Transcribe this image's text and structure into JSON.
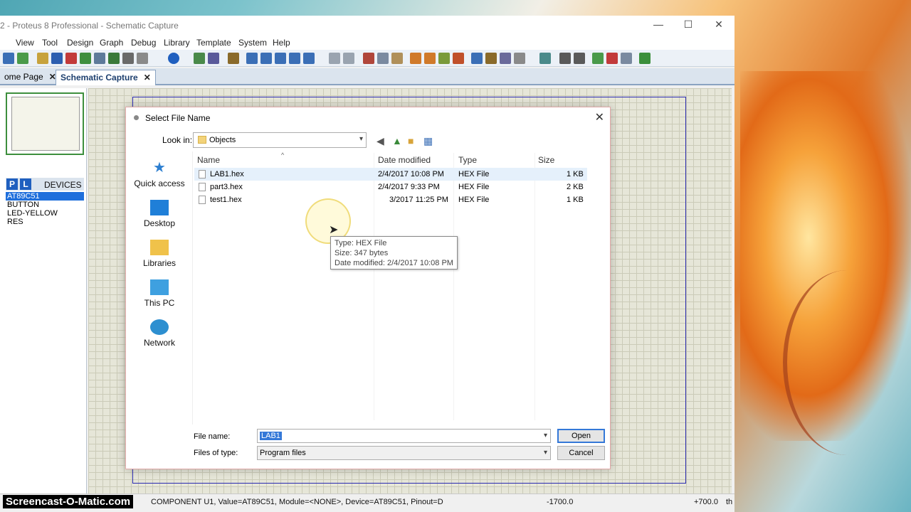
{
  "window": {
    "title": "2 - Proteus 8 Professional - Schematic Capture"
  },
  "menu": [
    "View",
    "Tool",
    "Design",
    "Graph",
    "Debug",
    "Library",
    "Template",
    "System",
    "Help"
  ],
  "tabs": [
    {
      "label": "ome Page"
    },
    {
      "label": "Schematic Capture"
    }
  ],
  "devices_panel": {
    "p_label": "P",
    "l_label": "L",
    "title": "DEVICES",
    "items": [
      "AT89C51",
      "BUTTON",
      "LED-YELLOW",
      "RES"
    ]
  },
  "statusbar": {
    "component_info": "COMPONENT U1, Value=AT89C51, Module=<NONE>, Device=AT89C51, Pinout=D",
    "x_coord": "-1700.0",
    "y_coord": "+700.0",
    "units": "th"
  },
  "watermark": "Screencast-O-Matic.com",
  "dialog": {
    "title": "Select File Name",
    "look_in_label": "Look in:",
    "look_in_value": "Objects",
    "places": [
      "Quick access",
      "Desktop",
      "Libraries",
      "This PC",
      "Network"
    ],
    "columns": [
      "Name",
      "Date modified",
      "Type",
      "Size"
    ],
    "files": [
      {
        "name": "LAB1.hex",
        "date": "2/4/2017 10:08 PM",
        "type": "HEX File",
        "size": "1 KB"
      },
      {
        "name": "part3.hex",
        "date": "2/4/2017 9:33 PM",
        "type": "HEX File",
        "size": "2 KB"
      },
      {
        "name": "test1.hex",
        "date": "3/2017 11:25 PM",
        "type": "HEX File",
        "size": "1 KB"
      }
    ],
    "tooltip": {
      "line1": "Type: HEX File",
      "line2": "Size: 347 bytes",
      "line3": "Date modified: 2/4/2017 10:08 PM"
    },
    "file_name_label": "File name:",
    "file_name_value": "LAB1",
    "files_of_type_label": "Files of type:",
    "files_of_type_value": "Program files",
    "open_label": "Open",
    "cancel_label": "Cancel"
  }
}
